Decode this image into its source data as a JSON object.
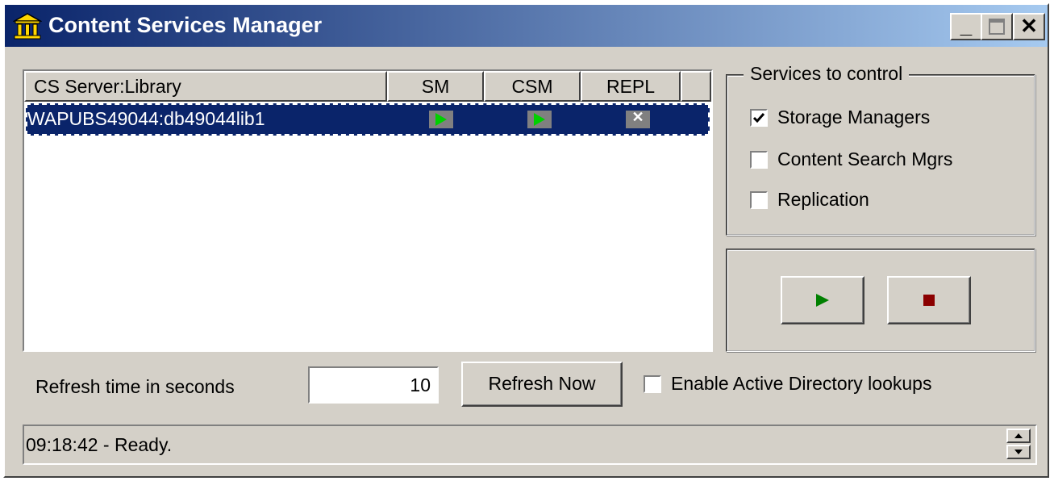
{
  "window": {
    "title": "Content Services Manager"
  },
  "titlebar_buttons": {
    "minimize": "_",
    "close": "✕"
  },
  "list": {
    "columns": [
      "CS Server:Library",
      "SM",
      "CSM",
      "REPL",
      ""
    ],
    "rows": [
      {
        "name": "WAPUBS49044:db49044lib1",
        "sm": "play-icon",
        "csm": "play-icon",
        "repl": "x-icon"
      }
    ]
  },
  "services": {
    "title": "Services to control",
    "options": [
      {
        "label": "Storage Managers",
        "checked": true
      },
      {
        "label": "Content Search Mgrs",
        "checked": false
      },
      {
        "label": "Replication",
        "checked": false
      }
    ]
  },
  "controls": {
    "start_icon": "play-icon",
    "stop_icon": "stop-icon"
  },
  "refresh": {
    "label": "Refresh time in seconds",
    "value": "10",
    "button_label": "Refresh Now"
  },
  "active_directory": {
    "label": "Enable Active Directory lookups",
    "checked": false
  },
  "status": {
    "text": "09:18:42 - Ready."
  },
  "colors": {
    "title_gradient_start": "#0a246a",
    "title_gradient_end": "#a6caf0",
    "selection": "#0a246a",
    "play": "#00d000",
    "stop": "#8b0000"
  }
}
